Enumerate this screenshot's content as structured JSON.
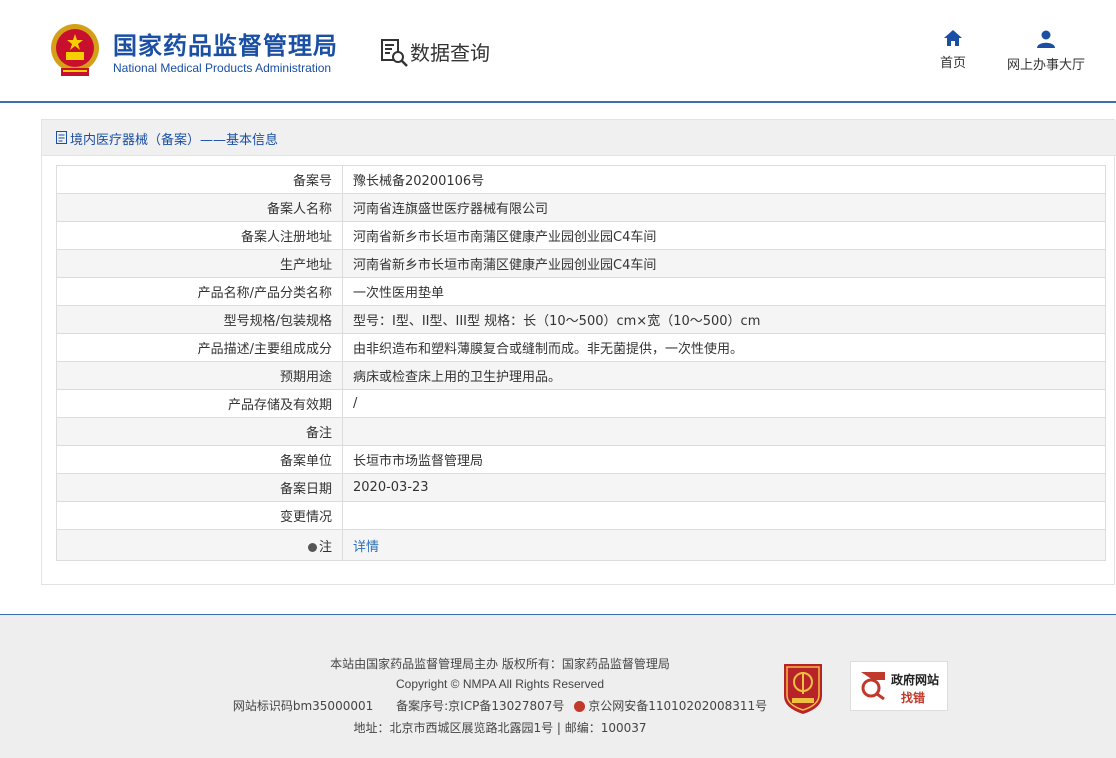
{
  "header": {
    "org_cn": "国家药品监督管理局",
    "org_en": "National Medical Products Administration",
    "query_label": "数据查询",
    "nav": [
      {
        "label": "首页",
        "icon": "home-icon"
      },
      {
        "label": "网上办事大厅",
        "icon": "user-icon"
      }
    ]
  },
  "panel": {
    "title": "境内医疗器械（备案）——基本信息",
    "rows": [
      {
        "label": "备案号",
        "value": "豫长械备20200106号"
      },
      {
        "label": "备案人名称",
        "value": "河南省连旗盛世医疗器械有限公司"
      },
      {
        "label": "备案人注册地址",
        "value": "河南省新乡市长垣市南蒲区健康产业园创业园C4车间"
      },
      {
        "label": "生产地址",
        "value": "河南省新乡市长垣市南蒲区健康产业园创业园C4车间"
      },
      {
        "label": "产品名称/产品分类名称",
        "value": "一次性医用垫单"
      },
      {
        "label": "型号规格/包装规格",
        "value": "型号：I型、II型、III型 规格：长（10～500）cm×宽（10～500）cm"
      },
      {
        "label": "产品描述/主要组成成分",
        "value": "由非织造布和塑料薄膜复合或缝制而成。非无菌提供，一次性使用。"
      },
      {
        "label": "预期用途",
        "value": "病床或检查床上用的卫生护理用品。"
      },
      {
        "label": "产品存储及有效期",
        "value": "/"
      },
      {
        "label": "备注",
        "value": ""
      },
      {
        "label": "备案单位",
        "value": "长垣市市场监督管理局"
      },
      {
        "label": "备案日期",
        "value": "2020-03-23"
      },
      {
        "label": "变更情况",
        "value": ""
      }
    ],
    "note_row": {
      "label": "注",
      "link": "详情"
    }
  },
  "footer": {
    "line1": "本站由国家药品监督管理局主办 版权所有：国家药品监督管理局",
    "line2": "Copyright © NMPA All Rights Reserved",
    "site_id": "网站标识码bm35000001",
    "icp": "备案序号:京ICP备13027807号",
    "police": "京公网安备11010202008311号",
    "line4": "地址：北京市西城区展览路北露园1号 | 邮编：100037",
    "gov_badge_top": "政府网站",
    "gov_badge_bottom": "找错"
  },
  "colors": {
    "brand_blue": "#1a4fa3",
    "link_blue": "#2a6ebb",
    "accent_red": "#c0392b"
  }
}
